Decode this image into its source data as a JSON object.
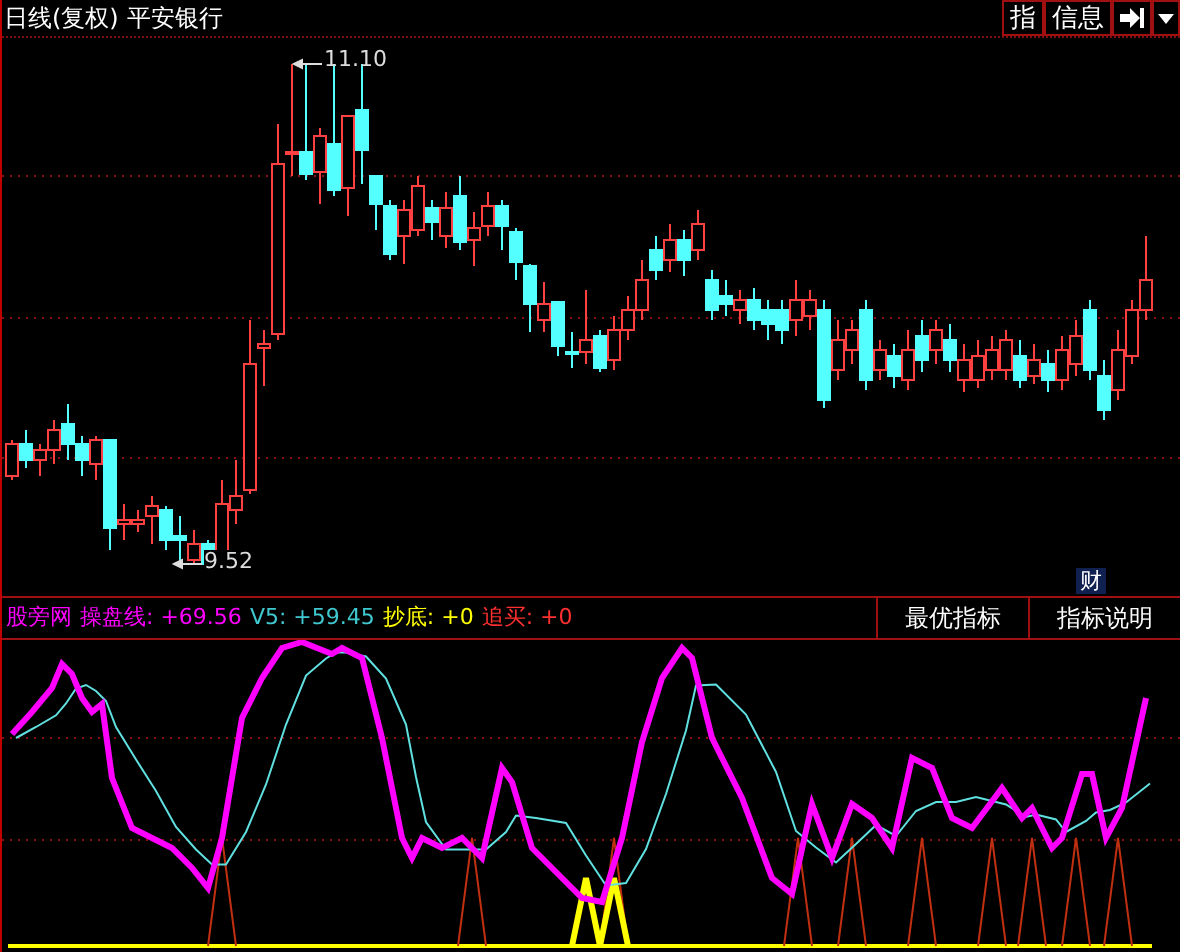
{
  "header": {
    "period": "日线(复权)",
    "stock_name": "平安银行",
    "buttons": [
      {
        "kind": "text",
        "label": "指"
      },
      {
        "kind": "text",
        "label": "信息"
      },
      {
        "kind": "jump"
      },
      {
        "kind": "caret"
      }
    ]
  },
  "price_chart": {
    "high_label": "11.10",
    "low_label": "9.52",
    "badge": "财"
  },
  "indicator": {
    "name": "股旁网",
    "lines": [
      {
        "label": "操盘线:",
        "value": "+69.56",
        "color": "#ff00ff"
      },
      {
        "label": "V5:",
        "value": "+59.45",
        "color": "#40c8d0"
      },
      {
        "label": "抄底:",
        "value": "+0",
        "color": "#ffff00"
      },
      {
        "label": "追买:",
        "value": "+0",
        "color": "#ff3030"
      }
    ],
    "buttons": [
      "最优指标",
      "指标说明"
    ]
  }
}
